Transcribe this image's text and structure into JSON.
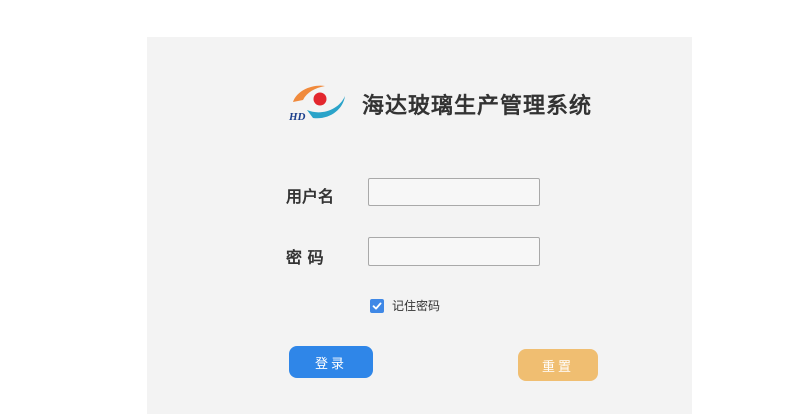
{
  "app": {
    "title": "海达玻璃生产管理系统",
    "logo_text": "HD"
  },
  "form": {
    "username_label": "用户名",
    "username_value": "",
    "password_label": "密 码",
    "password_value": "",
    "remember_label": "记住密码",
    "remember_checked": true
  },
  "buttons": {
    "login_label": "登录",
    "reset_label": "重置"
  },
  "colors": {
    "login_button": "#2f86e8",
    "reset_button": "#f0be71",
    "checkbox": "#3f88e6",
    "panel_background": "#f3f3f3"
  },
  "icons": {
    "logo": "hd-logo-icon",
    "checkbox": "checkmark-icon"
  }
}
